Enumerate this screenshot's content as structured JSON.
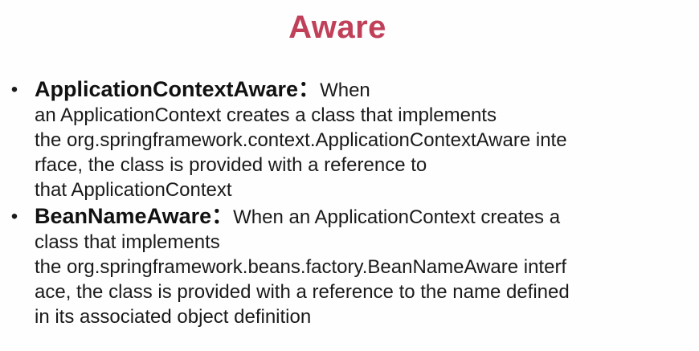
{
  "slide": {
    "title": "Aware",
    "bullets": [
      {
        "term": "ApplicationContextAware：",
        "lines": [
          "When",
          "an ApplicationContext creates a class that implements",
          "the org.springframework.context.ApplicationContextAware inte",
          "rface, the class is provided with a reference to",
          "that ApplicationContext"
        ]
      },
      {
        "term": "BeanNameAware：",
        "lines": [
          "When an ApplicationContext creates a",
          "class that implements",
          "the org.springframework.beans.factory.BeanNameAware interf",
          "ace, the class is provided with a reference to the name defined",
          "in its associated object definition"
        ]
      }
    ],
    "colors": {
      "title": "#c0405a",
      "text": "#1a1a1a"
    }
  }
}
